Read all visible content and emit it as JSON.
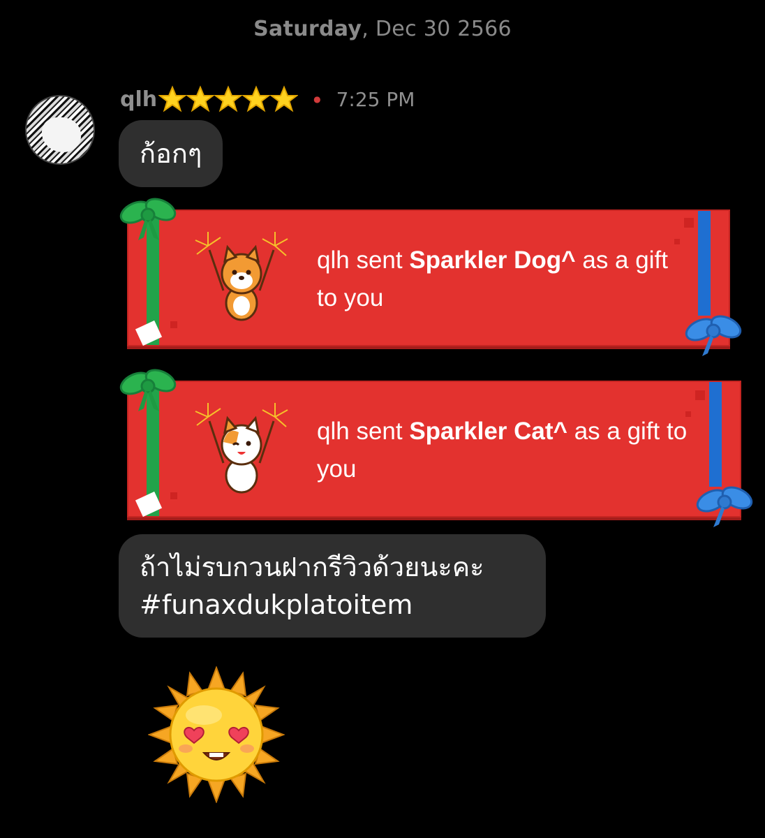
{
  "date_separator": {
    "day": "Saturday",
    "rest": ", Dec 30 2566"
  },
  "message": {
    "username": "qlh",
    "time": "7:25 PM",
    "star_icons": [
      "star-icon",
      "star-icon",
      "star-icon",
      "star-icon",
      "star-icon"
    ]
  },
  "bubbles": [
    {
      "lines": [
        "ก้อกๆ"
      ]
    },
    {
      "lines": [
        "ถ้าไม่รบกวนฝากรีวิวด้วยนะคะ",
        "#funaxdukplatoitem"
      ]
    }
  ],
  "gifts": [
    {
      "sender": "qlh",
      "pre": " sent ",
      "item": "Sparkler Dog^",
      "post": " as a gift to you",
      "animal_icon": "sparkler-dog-icon"
    },
    {
      "sender": "qlh",
      "pre": " sent ",
      "item": "Sparkler Cat^",
      "post": " as a gift to you",
      "animal_icon": "sparkler-cat-icon"
    }
  ],
  "sticker": {
    "icon": "heart-eyes-sun-sticker"
  },
  "colors": {
    "background": "#000000",
    "bubble": "#2f2f2f",
    "gift_red": "#e3322f",
    "ribbon_green": "#22a34a",
    "ribbon_blue": "#1f6fd1",
    "muted": "#8f8f8f"
  }
}
